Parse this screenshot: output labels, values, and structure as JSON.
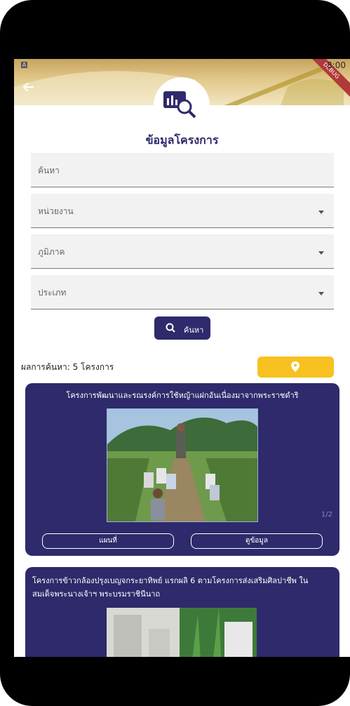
{
  "status_bar": {
    "indicator": "A",
    "time": "8:00",
    "debug_ribbon": "DEBUG"
  },
  "header": {
    "title": "ข้อมูลโครงการ"
  },
  "form": {
    "search_placeholder": "ค้นหา",
    "agency_label": "หน่วยงาน",
    "region_label": "ภูมิภาค",
    "type_label": "ประเภท",
    "search_button_label": "ค้นหา"
  },
  "results": {
    "count_text": "ผลการค้นหา: 5 โครงการ",
    "cards": [
      {
        "title": "โครงการพัฒนาและรณรงค์การใช้หญ้าแฝกอันเนื่องมาจากพระราชดำริ",
        "pager": "1/2",
        "map_button": "แผนที่",
        "detail_button": "ดูข้อมูล"
      },
      {
        "title": "โครงการข้าวกล้องปรุงเบญจกระยาทิพย์ แรกผลิ 6 ตามโครงการส่งเสริมศิลปาชีพ ใน สมเด็จพระนางเจ้าฯ พระบรมราชินีนาถ"
      }
    ]
  },
  "colors": {
    "primary": "#2e2a6b",
    "accent": "#f7c21f",
    "background": "#ffffff",
    "field": "#f2f2f2"
  },
  "icons": [
    "back-arrow-icon",
    "chart-search-logo-icon",
    "search-icon",
    "map-pin-icon",
    "chevron-down-icon"
  ]
}
